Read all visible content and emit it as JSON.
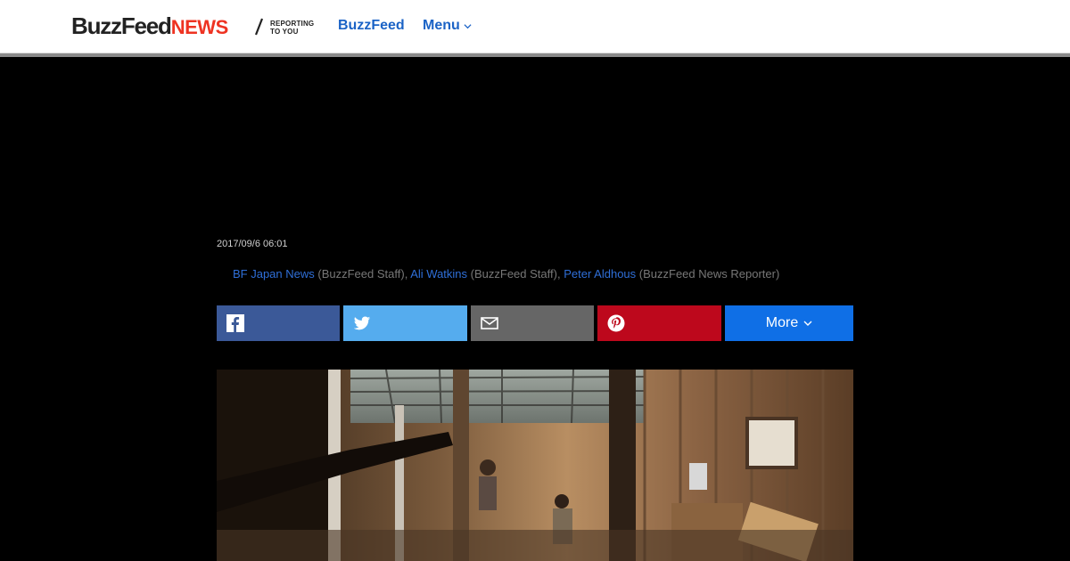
{
  "header": {
    "logo": {
      "buzz": "BuzzFeed",
      "news": "NEWS"
    },
    "tagline_line1": "REPORTING",
    "tagline_line2": "TO YOU",
    "nav": {
      "buzzfeed": "BuzzFeed",
      "menu": "Menu"
    }
  },
  "article": {
    "date": "2017/09/6 06:01",
    "authors": [
      {
        "name": "BF Japan News",
        "role": "(BuzzFeed Staff)"
      },
      {
        "name": "Ali Watkins",
        "role": "(BuzzFeed Staff)"
      },
      {
        "name": "Peter Aldhous",
        "role": "(BuzzFeed News Reporter)"
      }
    ]
  },
  "share": {
    "more_label": "More",
    "colors": {
      "facebook": "#3b5998",
      "twitter": "#55acee",
      "email": "#666666",
      "pinterest": "#bd081c",
      "more": "#0f6fe6"
    },
    "icons": [
      "facebook-icon",
      "twitter-icon",
      "email-icon",
      "pinterest-icon",
      "chevron-down-icon"
    ]
  },
  "colors": {
    "link": "#1b63c6",
    "news_red": "#ee3322",
    "background": "#000000"
  }
}
